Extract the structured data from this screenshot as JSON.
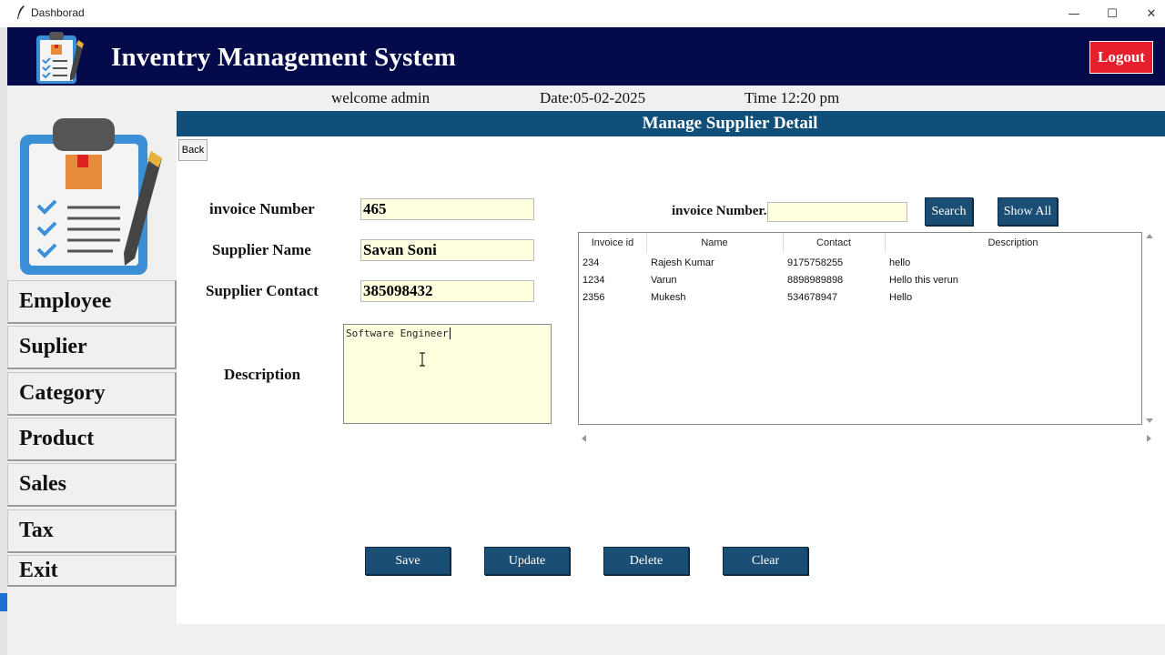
{
  "window": {
    "title": "Dashborad",
    "minimize": "—",
    "maximize": "☐",
    "close": "✕"
  },
  "header": {
    "app_title": "Inventry Management System",
    "logout_label": "Logout"
  },
  "info": {
    "welcome": "welcome admin",
    "date": "Date:05-02-2025",
    "time": "Time 12:20 pm"
  },
  "sidebar": {
    "items": [
      {
        "label": "Employee"
      },
      {
        "label": "Suplier"
      },
      {
        "label": "Category"
      },
      {
        "label": "Product"
      },
      {
        "label": "Sales"
      },
      {
        "label": "Tax"
      },
      {
        "label": "Exit"
      }
    ]
  },
  "main": {
    "heading": "Manage Supplier Detail",
    "back_label": "Back",
    "form": {
      "invoice_label": "invoice Number",
      "invoice_value": "465",
      "name_label": "Supplier Name",
      "name_value": "Savan Soni",
      "contact_label": "Supplier Contact",
      "contact_value": "385098432",
      "description_label": "Description",
      "description_value": "Software Engineer"
    },
    "search": {
      "label": "invoice Number.",
      "value": "",
      "search_button": "Search",
      "show_all_button": "Show All"
    },
    "table": {
      "columns": [
        "Invoice id",
        "Name",
        "Contact",
        "Description"
      ],
      "rows": [
        [
          "234",
          "Rajesh Kumar",
          "9175758255",
          "hello"
        ],
        [
          "1234",
          "Varun",
          "8898989898",
          "Hello this verun"
        ],
        [
          "2356",
          "Mukesh",
          "534678947",
          "Hello"
        ]
      ]
    },
    "actions": {
      "save": "Save",
      "update": "Update",
      "delete": "Delete",
      "clear": "Clear"
    }
  },
  "colors": {
    "header_bg": "#050a4a",
    "accent_bar": "#0f4f7a",
    "button_bg": "#1a4e74",
    "logout_bg": "#e5202c",
    "field_bg": "#ffffe0"
  }
}
